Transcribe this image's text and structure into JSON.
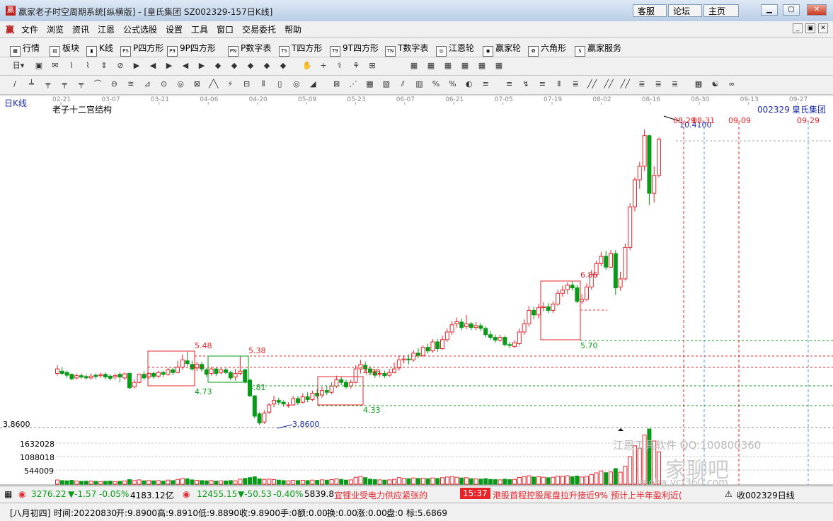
{
  "window": {
    "title": "赢家老子时空周期系统[纵横版] - [皇氏集团  SZ002329-157日K线]",
    "nav": [
      "客服",
      "论坛",
      "主页"
    ]
  },
  "menu": [
    "文件",
    "浏览",
    "资讯",
    "江恩",
    "公式选股",
    "设置",
    "工具",
    "窗口",
    "交易委托",
    "帮助"
  ],
  "toolbar1": [
    "行情",
    "板块",
    "K线",
    "P四方形",
    "9P四方形",
    "P数字表",
    "T四方形",
    "9T四方形",
    "T数字表",
    "江恩轮",
    "赢家轮",
    "六角形",
    "赢家服务"
  ],
  "toolbar1_icons": [
    "grid-icon",
    "blocks-icon",
    "candlestick-icon",
    "ps-icon",
    "p9-icon",
    "pn-icon",
    "ts-icon",
    "t9-icon",
    "tn-icon",
    "gann-wheel-icon",
    "winner-wheel-icon",
    "hexagon-icon",
    "dollar-icon"
  ],
  "toolbar1_iconglyphs": [
    "▦",
    "▤",
    "▮",
    "PS",
    "P9",
    "PN",
    "TS",
    "T9",
    "TN",
    "◎",
    "◉",
    "✿",
    "$"
  ],
  "chart": {
    "period_label": "日K线",
    "indicator_title": "老子十二宫结构",
    "stock_code": "002329",
    "stock_name": "皇氏集团",
    "month_ticks": [
      "02-21",
      "03-07",
      "03-21",
      "04-06",
      "04-20",
      "05-09",
      "05-23",
      "06-07",
      "06-21",
      "07-05",
      "07-19",
      "08-02",
      "08-16",
      "08-30",
      "09-13",
      "09-27"
    ],
    "price_labels": [
      "5.48",
      "5.38",
      "4.73",
      "4.81",
      "4.95",
      "4.33",
      "6.86",
      "5.70",
      "3.8600",
      "10.4100"
    ],
    "left_axis_price": "3.8600",
    "date_markers": [
      "08-29",
      "08-31",
      "09-09",
      "09-29"
    ],
    "volume_axis": [
      "1632028",
      "1088018",
      "544009"
    ],
    "watermark": "江恩工具软件  QQ:100800360",
    "watermark_site": "liaoba.ycf360.com",
    "watermark_big": "家聊吧"
  },
  "statusbar": {
    "sh_index": "3276.22",
    "sh_change": "▼-1.57",
    "sh_pct": "-0.05%",
    "sh_amount": "4183.12亿",
    "sz_index": "12455.15",
    "sz_change": "▼-50.53",
    "sz_pct": "-0.40%",
    "sz_amount": "5839.8",
    "news1": "宜锂业受电力供应紧张的",
    "news_time": "15:37",
    "news2": "港股首程控股尾盘拉升接近9% 预计上半年盈利近(",
    "right_label": "收002329日线"
  },
  "infobar": {
    "lunar": "[八月初四]",
    "time": "时间:20220830",
    "open": "开:9.8900",
    "high": "高:9.8910",
    "low": "低:9.8890",
    "close": "收:9.8900",
    "hand": "手:0",
    "amount": "额:0.00",
    "turnover": "换:0.00",
    "change": "涨:0.00",
    "pan": "盘:0",
    "mark": "标:5.6869"
  },
  "colors": {
    "up": "#e8242b",
    "down": "#0a9a1a",
    "blue": "#1a2ca8"
  },
  "candles": [
    [
      5.0,
      5.1,
      5.18,
      4.95
    ],
    [
      5.05,
      5.0,
      5.14,
      4.96
    ],
    [
      5.02,
      4.96,
      5.06,
      4.9
    ],
    [
      4.98,
      4.88,
      5.0,
      4.85
    ],
    [
      4.9,
      4.95,
      5.0,
      4.86
    ],
    [
      4.95,
      4.92,
      5.0,
      4.88
    ],
    [
      4.93,
      4.9,
      4.98,
      4.86
    ],
    [
      4.9,
      4.94,
      5.0,
      4.86
    ],
    [
      4.96,
      4.93,
      5.0,
      4.88
    ],
    [
      4.95,
      4.97,
      5.02,
      4.9
    ],
    [
      4.98,
      4.92,
      5.02,
      4.86
    ],
    [
      4.94,
      4.89,
      4.98,
      4.84
    ],
    [
      4.92,
      4.95,
      5.0,
      4.86
    ],
    [
      4.98,
      4.92,
      5.02,
      4.8
    ],
    [
      4.9,
      4.99,
      5.02,
      4.85
    ],
    [
      5.0,
      4.68,
      5.02,
      4.65
    ],
    [
      4.7,
      4.8,
      4.86,
      4.66
    ],
    [
      4.8,
      4.98,
      5.0,
      4.78
    ],
    [
      4.98,
      4.9,
      5.05,
      4.86
    ],
    [
      4.92,
      5.0,
      5.02,
      4.88
    ],
    [
      5.0,
      4.93,
      5.04,
      4.88
    ],
    [
      4.94,
      5.02,
      5.06,
      4.9
    ],
    [
      5.02,
      4.98,
      5.06,
      4.92
    ],
    [
      4.98,
      5.08,
      5.12,
      4.95
    ],
    [
      5.08,
      5.02,
      5.12,
      4.96
    ],
    [
      5.02,
      5.14,
      5.28,
      5.0
    ],
    [
      5.14,
      5.3,
      5.42,
      5.08
    ],
    [
      5.28,
      5.22,
      5.48,
      5.16
    ],
    [
      5.2,
      5.1,
      5.28,
      5.06
    ],
    [
      5.12,
      5.2,
      5.26,
      5.05
    ],
    [
      5.2,
      5.1,
      5.26,
      5.04
    ],
    [
      5.08,
      4.98,
      5.12,
      4.92
    ],
    [
      5.0,
      5.1,
      5.14,
      4.95
    ],
    [
      5.1,
      5.0,
      5.14,
      4.94
    ],
    [
      5.02,
      5.08,
      5.12,
      4.98
    ],
    [
      5.08,
      5.02,
      5.12,
      4.98
    ],
    [
      5.02,
      4.9,
      5.06,
      4.85
    ],
    [
      4.92,
      5.0,
      5.1,
      4.84
    ],
    [
      5.0,
      5.05,
      5.38,
      4.96
    ],
    [
      5.08,
      4.82,
      5.1,
      4.78
    ],
    [
      4.85,
      4.5,
      4.88,
      4.48
    ],
    [
      4.5,
      4.05,
      4.52,
      4.0
    ],
    [
      4.1,
      3.9,
      4.14,
      3.86
    ],
    [
      3.92,
      4.12,
      4.18,
      3.88
    ],
    [
      4.14,
      4.3,
      4.34,
      4.1
    ],
    [
      4.32,
      4.4,
      4.5,
      4.25
    ],
    [
      4.4,
      4.36,
      4.46,
      4.3
    ],
    [
      4.36,
      4.32,
      4.4,
      4.26
    ],
    [
      4.3,
      4.3,
      4.36,
      4.24
    ],
    [
      4.3,
      4.44,
      4.5,
      4.28
    ],
    [
      4.44,
      4.35,
      4.5,
      4.3
    ],
    [
      4.36,
      4.48,
      4.56,
      4.33
    ],
    [
      4.48,
      4.42,
      4.58,
      4.36
    ],
    [
      4.42,
      4.56,
      4.62,
      4.38
    ],
    [
      4.56,
      4.5,
      4.66,
      4.44
    ],
    [
      4.52,
      4.62,
      4.7,
      4.46
    ],
    [
      4.62,
      4.58,
      4.72,
      4.52
    ],
    [
      4.58,
      4.72,
      4.8,
      4.54
    ],
    [
      4.72,
      4.86,
      4.95,
      4.68
    ],
    [
      4.86,
      4.8,
      4.92,
      4.74
    ],
    [
      4.8,
      4.7,
      4.86,
      4.66
    ],
    [
      4.72,
      4.8,
      4.86,
      4.66
    ],
    [
      4.8,
      5.1,
      5.18,
      4.78
    ],
    [
      5.1,
      5.2,
      5.3,
      5.0
    ],
    [
      5.18,
      5.1,
      5.26,
      5.04
    ],
    [
      5.1,
      5.02,
      5.16,
      4.96
    ],
    [
      5.04,
      4.96,
      5.1,
      4.9
    ],
    [
      4.98,
      5.0,
      5.08,
      4.92
    ],
    [
      5.0,
      4.95,
      5.06,
      4.9
    ],
    [
      4.96,
      5.02,
      5.1,
      4.92
    ],
    [
      5.02,
      5.1,
      5.24,
      5.0
    ],
    [
      5.12,
      5.3,
      5.4,
      5.06
    ],
    [
      5.3,
      5.32,
      5.4,
      5.22
    ],
    [
      5.32,
      5.3,
      5.42,
      5.2
    ],
    [
      5.3,
      5.45,
      5.52,
      5.26
    ],
    [
      5.45,
      5.4,
      5.56,
      5.34
    ],
    [
      5.4,
      5.58,
      5.62,
      5.36
    ],
    [
      5.58,
      5.5,
      5.66,
      5.44
    ],
    [
      5.5,
      5.7,
      5.76,
      5.46
    ],
    [
      5.7,
      5.55,
      5.76,
      5.48
    ],
    [
      5.55,
      5.75,
      5.84,
      5.52
    ],
    [
      5.75,
      5.92,
      6.0,
      5.7
    ],
    [
      5.92,
      6.08,
      6.16,
      5.86
    ],
    [
      6.1,
      6.15,
      6.24,
      6.02
    ],
    [
      6.14,
      6.02,
      6.22,
      5.96
    ],
    [
      6.04,
      6.1,
      6.3,
      5.98
    ],
    [
      6.1,
      6.02,
      6.14,
      5.96
    ],
    [
      6.02,
      6.06,
      6.14,
      5.96
    ],
    [
      6.06,
      6.0,
      6.12,
      5.94
    ],
    [
      6.0,
      5.86,
      6.04,
      5.8
    ],
    [
      5.86,
      5.8,
      5.94,
      5.74
    ],
    [
      5.8,
      5.74,
      5.86,
      5.68
    ],
    [
      5.74,
      5.8,
      5.86,
      5.7
    ],
    [
      5.8,
      5.64,
      5.84,
      5.6
    ],
    [
      5.64,
      5.62,
      5.7,
      5.56
    ],
    [
      5.6,
      5.68,
      5.74,
      5.56
    ],
    [
      5.66,
      5.92,
      6.0,
      5.62
    ],
    [
      5.92,
      6.1,
      6.2,
      5.86
    ],
    [
      6.1,
      6.4,
      6.5,
      6.04
    ],
    [
      6.4,
      6.3,
      6.48,
      6.2
    ],
    [
      6.3,
      6.46,
      6.54,
      6.22
    ],
    [
      6.46,
      6.48,
      6.58,
      6.38
    ],
    [
      6.48,
      6.4,
      6.56,
      6.34
    ],
    [
      6.4,
      6.54,
      6.6,
      6.34
    ],
    [
      6.54,
      6.78,
      6.86,
      6.5
    ],
    [
      6.78,
      6.85,
      6.95,
      6.7
    ],
    [
      6.86,
      6.96,
      7.02,
      6.76
    ],
    [
      6.96,
      6.9,
      7.04,
      6.84
    ],
    [
      6.9,
      6.6,
      6.96,
      6.56
    ],
    [
      6.6,
      6.64,
      6.76,
      6.54
    ],
    [
      6.64,
      6.92,
      7.0,
      6.6
    ],
    [
      6.92,
      7.2,
      7.3,
      6.86
    ],
    [
      7.2,
      7.44,
      7.5,
      7.14
    ],
    [
      7.44,
      7.6,
      7.7,
      7.38
    ],
    [
      7.6,
      7.36,
      7.72,
      7.3
    ],
    [
      7.36,
      7.66,
      7.74,
      7.34
    ],
    [
      7.66,
      6.9,
      7.74,
      6.74
    ],
    [
      6.92,
      7.1,
      7.26,
      6.84
    ],
    [
      7.1,
      7.8,
      7.88,
      7.06
    ],
    [
      7.8,
      8.7,
      8.78,
      7.74
    ],
    [
      8.7,
      9.3,
      9.36,
      8.6
    ],
    [
      9.3,
      9.6,
      9.7,
      9.1
    ],
    [
      9.6,
      10.28,
      10.41,
      9.5
    ],
    [
      10.28,
      9.0,
      10.3,
      8.74
    ],
    [
      9.0,
      9.4,
      9.6,
      8.8
    ],
    [
      9.4,
      10.2,
      10.24,
      9.36
    ]
  ],
  "volumes": [
    0.35,
    0.3,
    0.28,
    0.32,
    0.26,
    0.24,
    0.25,
    0.26,
    0.24,
    0.22,
    0.24,
    0.26,
    0.22,
    0.24,
    0.27,
    0.38,
    0.3,
    0.36,
    0.28,
    0.3,
    0.28,
    0.3,
    0.26,
    0.34,
    0.3,
    0.4,
    0.48,
    0.45,
    0.36,
    0.32,
    0.3,
    0.28,
    0.3,
    0.26,
    0.28,
    0.27,
    0.3,
    0.28,
    0.42,
    0.48,
    0.55,
    0.62,
    0.45,
    0.4,
    0.42,
    0.38,
    0.34,
    0.3,
    0.28,
    0.32,
    0.3,
    0.32,
    0.3,
    0.34,
    0.32,
    0.36,
    0.34,
    0.38,
    0.45,
    0.4,
    0.34,
    0.36,
    0.58,
    0.65,
    0.55,
    0.42,
    0.38,
    0.36,
    0.34,
    0.36,
    0.4,
    0.55,
    0.5,
    0.46,
    0.52,
    0.48,
    0.5,
    0.46,
    0.52,
    0.48,
    0.54,
    0.6,
    0.64,
    0.58,
    0.52,
    0.54,
    0.46,
    0.44,
    0.42,
    0.46,
    0.4,
    0.38,
    0.36,
    0.42,
    0.38,
    0.4,
    0.56,
    0.62,
    0.7,
    0.6,
    0.62,
    0.58,
    0.54,
    0.58,
    0.68,
    0.66,
    0.7,
    0.62,
    0.68,
    0.6,
    0.66,
    0.8,
    0.94,
    1.1,
    0.96,
    1.02,
    1.3,
    1.0,
    1.5,
    2.3,
    3.2,
    3.0,
    4.1,
    4.6,
    3.6,
    2.7
  ],
  "boxes": [
    [
      209,
      496,
      275,
      545,
      "up"
    ],
    [
      294,
      503,
      351,
      540,
      "down"
    ],
    [
      449,
      532,
      513,
      572,
      "up"
    ],
    [
      764,
      397,
      820,
      480,
      "up"
    ]
  ],
  "hlines": [
    [
      519,
      "#e8242b",
      209,
      1177
    ],
    [
      503,
      "#e8242b",
      275,
      1177
    ],
    [
      481,
      "#0a9a1a",
      820,
      1177
    ],
    [
      573,
      "#0a9a1a",
      449,
      1177
    ],
    [
      545,
      "#0a9a1a",
      351,
      1177
    ],
    [
      438,
      "#e8242b",
      820,
      858
    ],
    [
      199,
      "#aaaaaa",
      955,
      1177
    ],
    [
      604,
      "#888888",
      0,
      1177
    ]
  ],
  "vlines": [
    [
      966,
      "#e8242b"
    ],
    [
      995,
      "#5b9bd5"
    ],
    [
      1044,
      "#e8242b"
    ],
    [
      1142,
      "#5b9bd5"
    ]
  ]
}
